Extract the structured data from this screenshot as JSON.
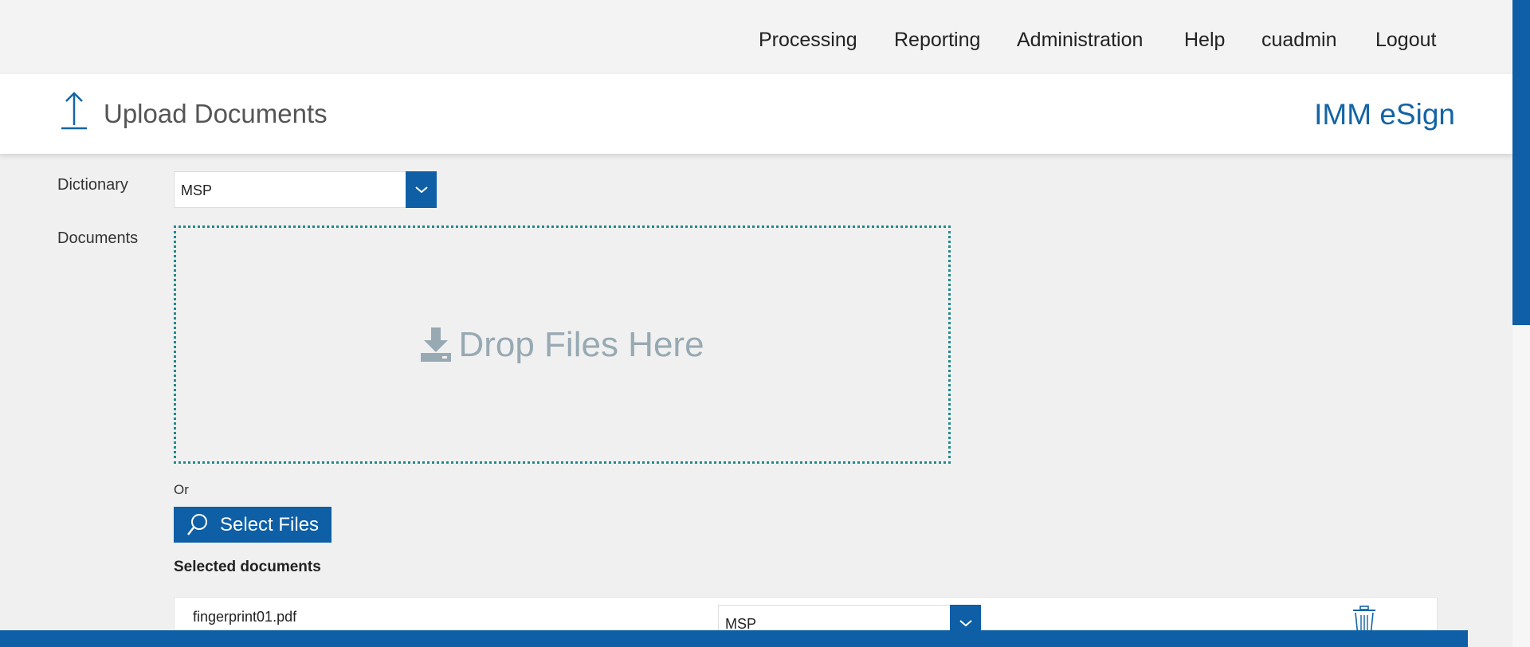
{
  "nav": {
    "items": [
      {
        "label": "Processing"
      },
      {
        "label": "Reporting"
      },
      {
        "label": "Administration"
      },
      {
        "label": "Help"
      },
      {
        "label": "cuadmin"
      },
      {
        "label": "Logout"
      }
    ]
  },
  "header": {
    "title": "Upload Documents",
    "brand": "IMM eSign",
    "icon": "upload-icon"
  },
  "form": {
    "dictionary_label": "Dictionary",
    "dictionary_value": "MSP",
    "documents_label": "Documents",
    "drop_text": "Drop Files Here",
    "or_label": "Or",
    "select_files_label": "Select Files",
    "selected_heading": "Selected documents"
  },
  "documents": [
    {
      "name": "fingerprint01.pdf",
      "dictionary": "MSP"
    }
  ],
  "colors": {
    "accent": "#0e5fa5",
    "dropzone_border": "#1f8a8a",
    "drop_text": "#97a9b3"
  }
}
